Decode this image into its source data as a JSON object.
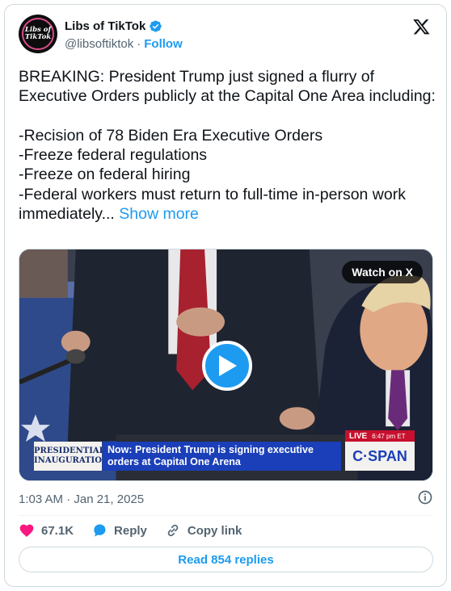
{
  "author": {
    "name": "Libs of TikTok",
    "handle": "@libsoftiktok",
    "follow_label": "Follow",
    "avatar_icon": "libs-of-tiktok-logo",
    "avatar_text": "Libs of TikTok"
  },
  "tweet": {
    "text": "BREAKING: President Trump just signed a flurry of Executive Orders publicly at the Capital One Area including:\n\n-Recision of 78 Biden Era Executive Orders\n-Freeze federal regulations\n-Freeze on federal hiring\n-Federal workers must return to full-time in-person work immediately... ",
    "show_more": "Show more"
  },
  "media": {
    "watch_label": "Watch on X",
    "play_icon": "play-icon",
    "chyron": {
      "left": "PRESIDENTIAL INAUGURATION",
      "headline": "Now: President Trump is signing executive orders at Capital One Arena",
      "live": "LIVE",
      "time": "6:47 pm ET",
      "network": "C·SPAN"
    }
  },
  "timestamp": "1:03 AM · Jan 21, 2025",
  "actions": {
    "likes": "67.1K",
    "reply_label": "Reply",
    "copy_label": "Copy link"
  },
  "read_replies": "Read 854 replies",
  "colors": {
    "accent": "#1d9bf0",
    "like": "#f91880",
    "text": "#0f1419",
    "secondary": "#536471"
  }
}
